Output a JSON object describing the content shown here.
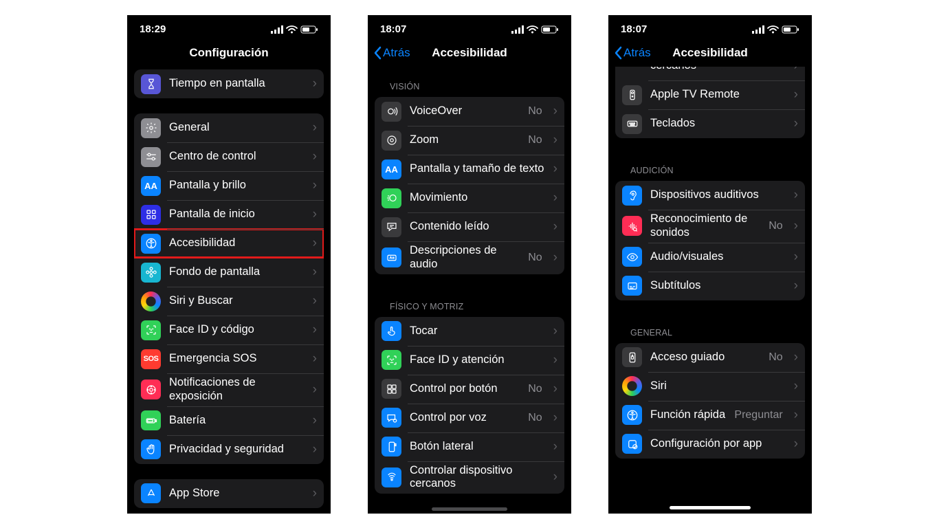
{
  "phones": [
    {
      "time": "18:29",
      "title": "Configuración",
      "back": null,
      "sections": [
        {
          "header": null,
          "rows": [
            {
              "icon_bg": "#5856d6",
              "icon": "hourglass",
              "label": "Tiempo en pantalla"
            }
          ]
        },
        {
          "header": null,
          "rows": [
            {
              "icon_bg": "#8e8e93",
              "icon": "gear",
              "label": "General"
            },
            {
              "icon_bg": "#8e8e93",
              "icon": "sliders",
              "label": "Centro de control"
            },
            {
              "icon_bg": "#0a84ff",
              "icon": "aa",
              "label": "Pantalla y brillo"
            },
            {
              "icon_bg": "#2e2ee5",
              "icon": "grid",
              "label": "Pantalla de inicio"
            },
            {
              "icon_bg": "#0a84ff",
              "icon": "accessibility",
              "label": "Accesibilidad",
              "highlight": true
            },
            {
              "icon_bg": "#18b6d1",
              "icon": "flower",
              "label": "Fondo de pantalla"
            },
            {
              "icon_bg": "#1c1c1e",
              "icon": "siri",
              "label": "Siri y Buscar",
              "siri": true
            },
            {
              "icon_bg": "#30d158",
              "icon": "faceid",
              "label": "Face ID y código"
            },
            {
              "icon_bg": "#ff3b30",
              "icon": "sos",
              "label": "Emergencia SOS"
            },
            {
              "icon_bg": "#ff2d55",
              "icon": "exposure",
              "label": "Notificaciones de exposición"
            },
            {
              "icon_bg": "#30d158",
              "icon": "battery",
              "label": "Batería"
            },
            {
              "icon_bg": "#0a84ff",
              "icon": "hand",
              "label": "Privacidad y seguridad"
            }
          ]
        },
        {
          "header": null,
          "rows": [
            {
              "icon_bg": "#0a84ff",
              "icon": "appstore",
              "label": "App Store"
            }
          ]
        }
      ]
    },
    {
      "time": "18:07",
      "title": "Accesibilidad",
      "back": "Atrás",
      "sections": [
        {
          "header": "VISIÓN",
          "rows": [
            {
              "icon_bg": "#3a3a3c",
              "icon": "voiceover",
              "label": "VoiceOver",
              "value": "No"
            },
            {
              "icon_bg": "#3a3a3c",
              "icon": "zoom",
              "label": "Zoom",
              "value": "No"
            },
            {
              "icon_bg": "#0a84ff",
              "icon": "aa",
              "label": "Pantalla y tamaño de texto"
            },
            {
              "icon_bg": "#30d158",
              "icon": "motion",
              "label": "Movimiento"
            },
            {
              "icon_bg": "#3a3a3c",
              "icon": "speech",
              "label": "Contenido leído"
            },
            {
              "icon_bg": "#0a84ff",
              "icon": "audiodesc",
              "label": "Descripciones de audio",
              "value": "No"
            }
          ]
        },
        {
          "header": "FÍSICO Y MOTRIZ",
          "rows": [
            {
              "icon_bg": "#0a84ff",
              "icon": "touch",
              "label": "Tocar"
            },
            {
              "icon_bg": "#30d158",
              "icon": "faceid",
              "label": "Face ID y atención"
            },
            {
              "icon_bg": "#3a3a3c",
              "icon": "switch",
              "label": "Control por botón",
              "value": "No"
            },
            {
              "icon_bg": "#0a84ff",
              "icon": "voice",
              "label": "Control por voz",
              "value": "No"
            },
            {
              "icon_bg": "#0a84ff",
              "icon": "sidebtn",
              "label": "Botón lateral"
            },
            {
              "icon_bg": "#0a84ff",
              "icon": "nearby",
              "label": "Controlar dispositivo cercanos"
            }
          ]
        }
      ]
    },
    {
      "time": "18:07",
      "title": "Accesibilidad",
      "back": "Atrás",
      "home_indicator": true,
      "pre_rows": [
        {
          "icon_bg": "#3a3a3c",
          "icon": "empty",
          "label": "cercanos",
          "partial": true
        },
        {
          "icon_bg": "#3a3a3c",
          "icon": "remote",
          "label": "Apple TV Remote"
        },
        {
          "icon_bg": "#3a3a3c",
          "icon": "keyboard",
          "label": "Teclados"
        }
      ],
      "sections": [
        {
          "header": "AUDICIÓN",
          "rows": [
            {
              "icon_bg": "#0a84ff",
              "icon": "ear",
              "label": "Dispositivos auditivos"
            },
            {
              "icon_bg": "#ff2d55",
              "icon": "soundrec",
              "label": "Reconocimiento de sonidos",
              "value": "No"
            },
            {
              "icon_bg": "#0a84ff",
              "icon": "eye",
              "label": "Audio/visuales"
            },
            {
              "icon_bg": "#0a84ff",
              "icon": "subtitles",
              "label": "Subtítulos"
            }
          ]
        },
        {
          "header": "GENERAL",
          "rows": [
            {
              "icon_bg": "#3a3a3c",
              "icon": "guided",
              "label": "Acceso guiado",
              "value": "No"
            },
            {
              "icon_bg": "#1c1c1e",
              "icon": "siri",
              "label": "Siri",
              "siri": true
            },
            {
              "icon_bg": "#0a84ff",
              "icon": "accessibility",
              "label": "Función rápida",
              "value": "Preguntar"
            },
            {
              "icon_bg": "#0a84ff",
              "icon": "perapp",
              "label": "Configuración por app"
            }
          ]
        }
      ]
    }
  ]
}
